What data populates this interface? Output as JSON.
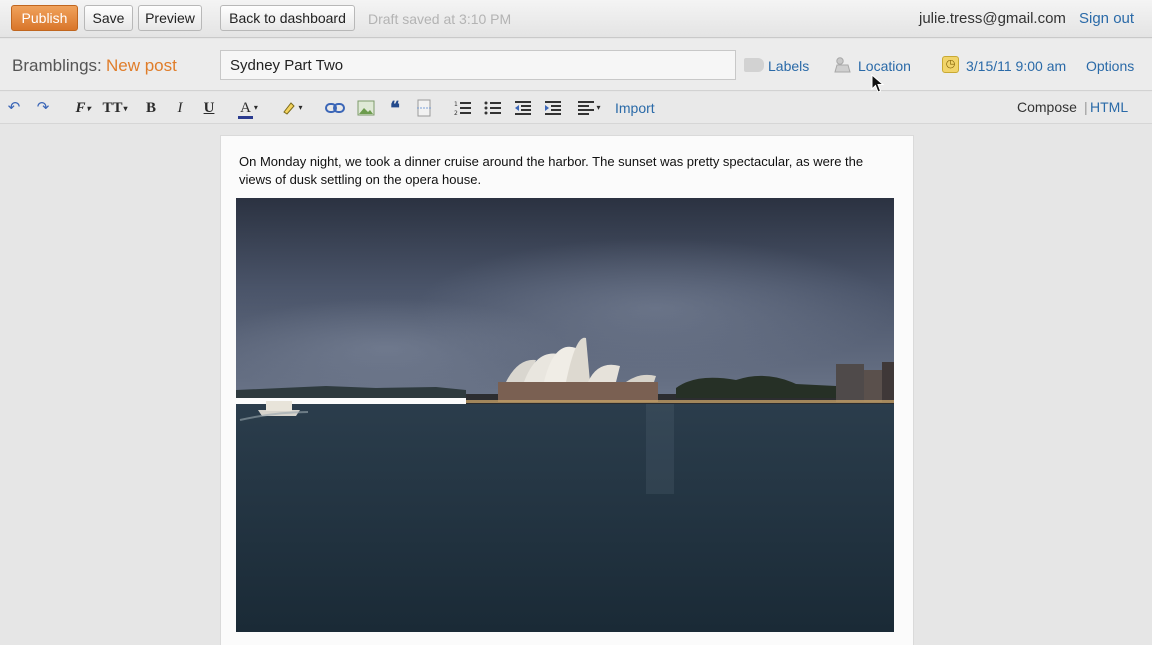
{
  "topbar": {
    "publish_label": "Publish",
    "save_label": "Save",
    "preview_label": "Preview",
    "back_label": "Back to dashboard",
    "draft_status": "Draft saved at 3:10 PM",
    "user_email": "julie.tress@gmail.com",
    "signout_label": "Sign out"
  },
  "titlebar": {
    "blog_name": "Bramblings:",
    "page_label": "New post",
    "post_title": "Sydney Part Two",
    "labels_label": "Labels",
    "location_label": "Location",
    "date_label": "3/15/11 9:00 am",
    "options_label": "Options"
  },
  "toolbar": {
    "import_label": "Import",
    "compose_label": "Compose",
    "separator": "|",
    "html_label": "HTML",
    "icons": [
      "undo-icon",
      "redo-icon",
      "font-family-icon",
      "font-size-icon",
      "bold-icon",
      "italic-icon",
      "underline-icon",
      "text-color-icon",
      "highlight-icon",
      "link-icon",
      "image-icon",
      "quote-icon",
      "jump-break-icon",
      "numbered-list-icon",
      "bullet-list-icon",
      "outdent-icon",
      "indent-icon",
      "align-icon"
    ]
  },
  "editor": {
    "paragraph": "On Monday night, we took a dinner cruise around the harbor. The sunset was pretty spectacular, as were the views of dusk settling on the opera house."
  },
  "colors": {
    "publish": "#e08435",
    "link": "#2a6aa8",
    "accent_orange": "#e07d2a"
  }
}
